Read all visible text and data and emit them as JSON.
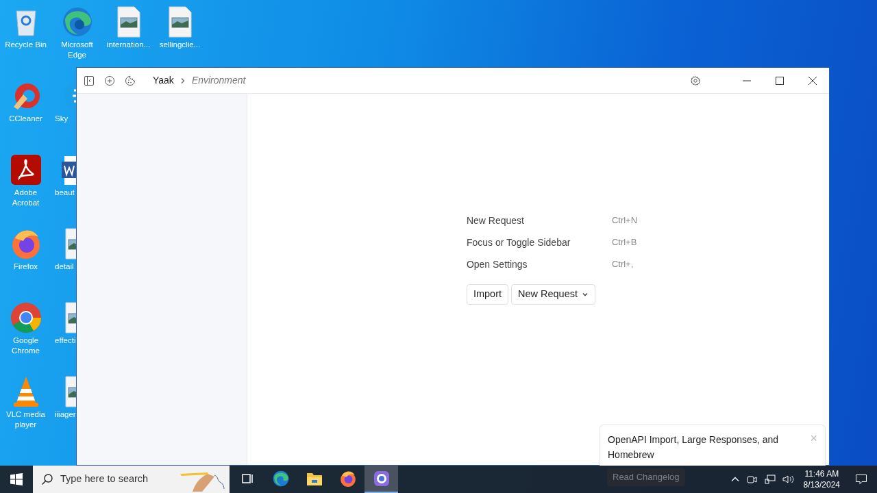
{
  "desktop_icons": [
    {
      "label": "Recycle Bin",
      "kind": "recycle"
    },
    {
      "label": "CCleaner",
      "kind": "ccleaner"
    },
    {
      "label": "Adobe Acrobat",
      "kind": "acrobat"
    },
    {
      "label": "Firefox",
      "kind": "firefox"
    },
    {
      "label": "Google Chrome",
      "kind": "chrome"
    },
    {
      "label": "VLC media player",
      "kind": "vlc"
    },
    {
      "label": "Microsoft Edge",
      "kind": "edge"
    },
    {
      "label": "Sky",
      "kind": "skype"
    },
    {
      "label": "beaut",
      "kind": "word"
    },
    {
      "label": "detail",
      "kind": "image"
    },
    {
      "label": "effecti",
      "kind": "image"
    },
    {
      "label": "iiiager",
      "kind": "image"
    },
    {
      "label": "internation...",
      "kind": "image"
    },
    {
      "label": "sellingclie...",
      "kind": "image"
    }
  ],
  "window": {
    "breadcrumb": [
      "Yaak",
      "Environment"
    ],
    "shortcuts": [
      {
        "label": "New Request",
        "keys": "Ctrl+N"
      },
      {
        "label": "Focus or Toggle Sidebar",
        "keys": "Ctrl+B"
      },
      {
        "label": "Open Settings",
        "keys": "Ctrl+,"
      }
    ],
    "buttons": [
      {
        "label": "Import",
        "kind": "plain"
      },
      {
        "label": "New Request",
        "kind": "dropdown"
      }
    ]
  },
  "toast": {
    "message": "OpenAPI Import, Large Responses, and Homebrew",
    "close": "×",
    "button": "Read Changelog"
  },
  "taskbar": {
    "search_placeholder": "Type here to search",
    "apps": [
      {
        "kind": "taskview",
        "selected": false
      },
      {
        "kind": "edge",
        "selected": false
      },
      {
        "kind": "folder",
        "selected": false
      },
      {
        "kind": "firefox",
        "selected": false
      },
      {
        "kind": "yaak",
        "selected": true
      }
    ],
    "time": "11:46 AM",
    "date": "8/13/2024"
  }
}
